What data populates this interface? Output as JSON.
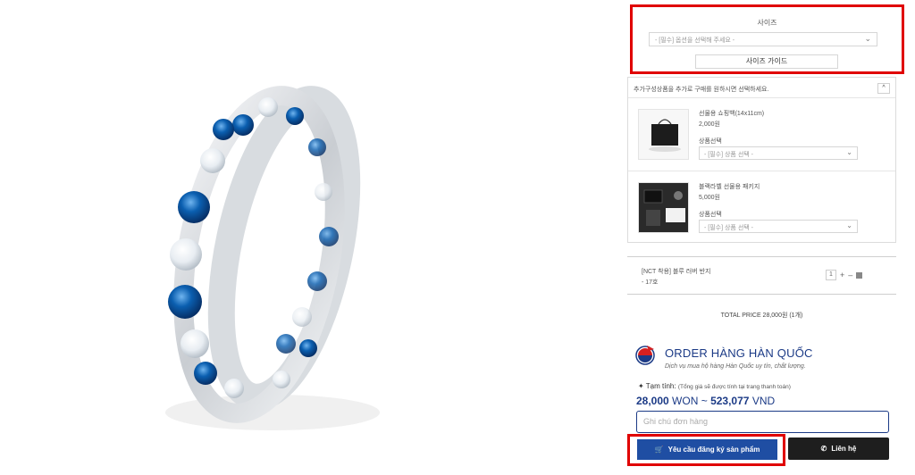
{
  "size": {
    "title": "사이즈",
    "select_placeholder": "- [필수] 옵션을 선택해 주세요 -",
    "guide_label": "사이즈 가이드"
  },
  "addon": {
    "header": "추가구성상품을 추가로 구매를 원하시면 선택하세요.",
    "collapse": "^",
    "items": [
      {
        "name": "선물용 쇼핑백(14x11cm)",
        "price": "2,000원",
        "option_label": "상품선택",
        "select": "- [필수] 상품 선택 -"
      },
      {
        "name": "블랙라벨 선물용 패키지",
        "price": "5,000원",
        "option_label": "상품선택",
        "select": "- [필수] 상품 선택 -"
      }
    ]
  },
  "line_item": {
    "name": "[NCT 착용] 블루 러버 반지",
    "option": "- 17호",
    "qty": "1"
  },
  "total": {
    "text": "TOTAL PRICE   28,000원 (1개)"
  },
  "order": {
    "title": "ORDER HÀNG HÀN QUỐC",
    "subtitle": "Dịch vụ mua hộ hàng Hàn Quốc uy tín, chất lượng.",
    "estimate_label": "Tạm tính:",
    "estimate_note": "(Tổng giá sẽ được tính tại trang thanh toán)",
    "price_won": "28,000",
    "won_unit": "WON",
    "tilde": "~",
    "price_vnd": "523,077",
    "vnd_unit": "VND",
    "note_placeholder": "Ghi chú đơn hàng",
    "request_button": "Yêu cầu đăng ký sản phẩm",
    "contact_button": "Liên hệ"
  },
  "colors": {
    "brand": "#1f4ea3",
    "highlight": "#e00000",
    "ring_blue": "#0b5fb0"
  }
}
